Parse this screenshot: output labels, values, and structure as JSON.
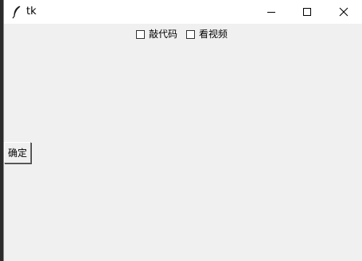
{
  "window": {
    "title": "tk",
    "titlebar_color": "#ffffff",
    "background_color": "#f0f0f0"
  },
  "icons": {
    "app": "feather-icon",
    "minimize": "minimize-icon",
    "maximize": "maximize-icon",
    "close": "close-icon"
  },
  "checkboxes": [
    {
      "label": "敲代码",
      "checked": false
    },
    {
      "label": "看视频",
      "checked": false
    }
  ],
  "buttons": {
    "ok_label": "确定"
  }
}
